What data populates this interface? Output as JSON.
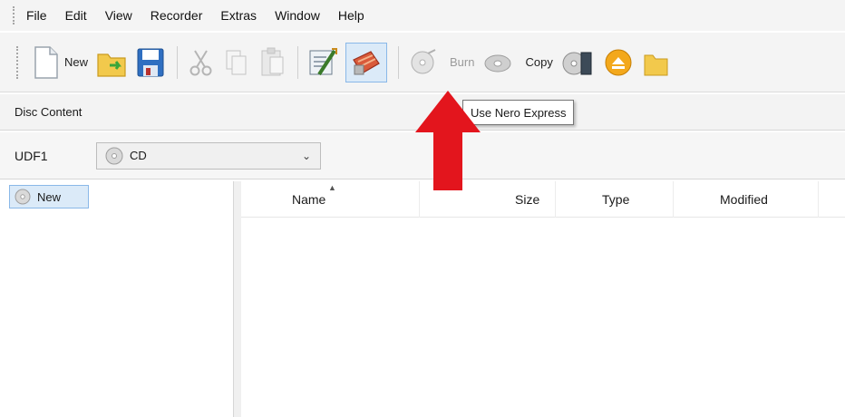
{
  "menu": [
    "File",
    "Edit",
    "View",
    "Recorder",
    "Extras",
    "Window",
    "Help"
  ],
  "toolbar": {
    "new_label": "New",
    "burn_label": "Burn",
    "copy_label": "Copy"
  },
  "tooltip": "Use Nero Express",
  "disc_content": {
    "title": "Disc Content"
  },
  "format": {
    "label": "UDF1",
    "value": "CD"
  },
  "tree": {
    "item": "New"
  },
  "columns": [
    "Name",
    "Size",
    "Type",
    "Modified"
  ],
  "colors": {
    "accent": "#dbeaf8",
    "arrow": "#e3151d"
  }
}
